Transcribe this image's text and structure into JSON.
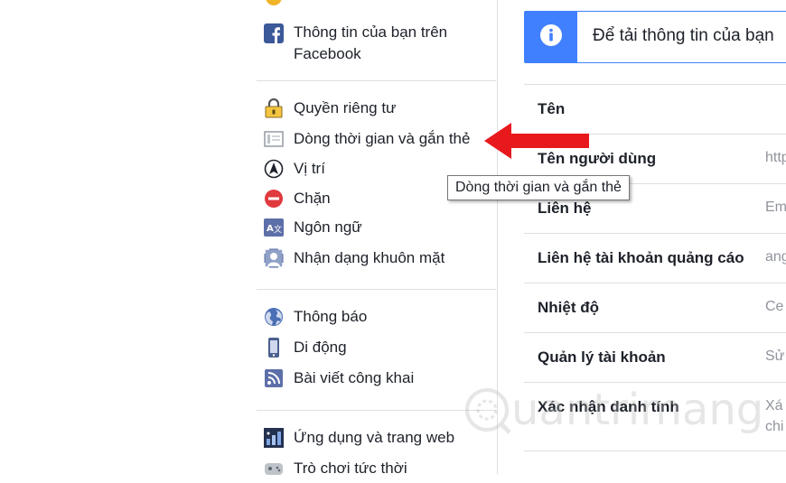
{
  "sidebar": {
    "items": [
      {
        "label_line1": "Thông tin của bạn trên",
        "label_line2": "Facebook"
      },
      {
        "label": "Quyền riêng tư"
      },
      {
        "label": "Dòng thời gian và gắn thẻ"
      },
      {
        "label": "Vị trí"
      },
      {
        "label": "Chặn"
      },
      {
        "label": "Ngôn ngữ"
      },
      {
        "label": "Nhận dạng khuôn mặt"
      },
      {
        "label": "Thông báo"
      },
      {
        "label": "Di động"
      },
      {
        "label": "Bài viết công khai"
      },
      {
        "label": "Ứng dụng và trang web"
      },
      {
        "label": "Trò chơi tức thời"
      }
    ]
  },
  "tooltip": {
    "text": "Dòng thời gian và gắn thẻ"
  },
  "banner": {
    "text": "Để tải thông tin của bạn"
  },
  "settings": {
    "rows": [
      {
        "label": "Tên",
        "value": ""
      },
      {
        "label": "Tên người dùng",
        "value": "http"
      },
      {
        "label": "Liên hệ",
        "value": "Em"
      },
      {
        "label": "Liên hệ tài khoản quảng cáo",
        "value": "ang"
      },
      {
        "label": "Nhiệt độ",
        "value": "Ce"
      },
      {
        "label": "Quản lý tài khoản",
        "value": "Sử"
      },
      {
        "label": "Xác nhận danh tính",
        "value": "Xá",
        "value2": "chi"
      }
    ]
  },
  "watermark": {
    "text": "uantrimang"
  },
  "colors": {
    "brand": "#4080ff",
    "facebook": "#3b5998",
    "arrow": "#e8191d",
    "block": "#e0393e"
  }
}
